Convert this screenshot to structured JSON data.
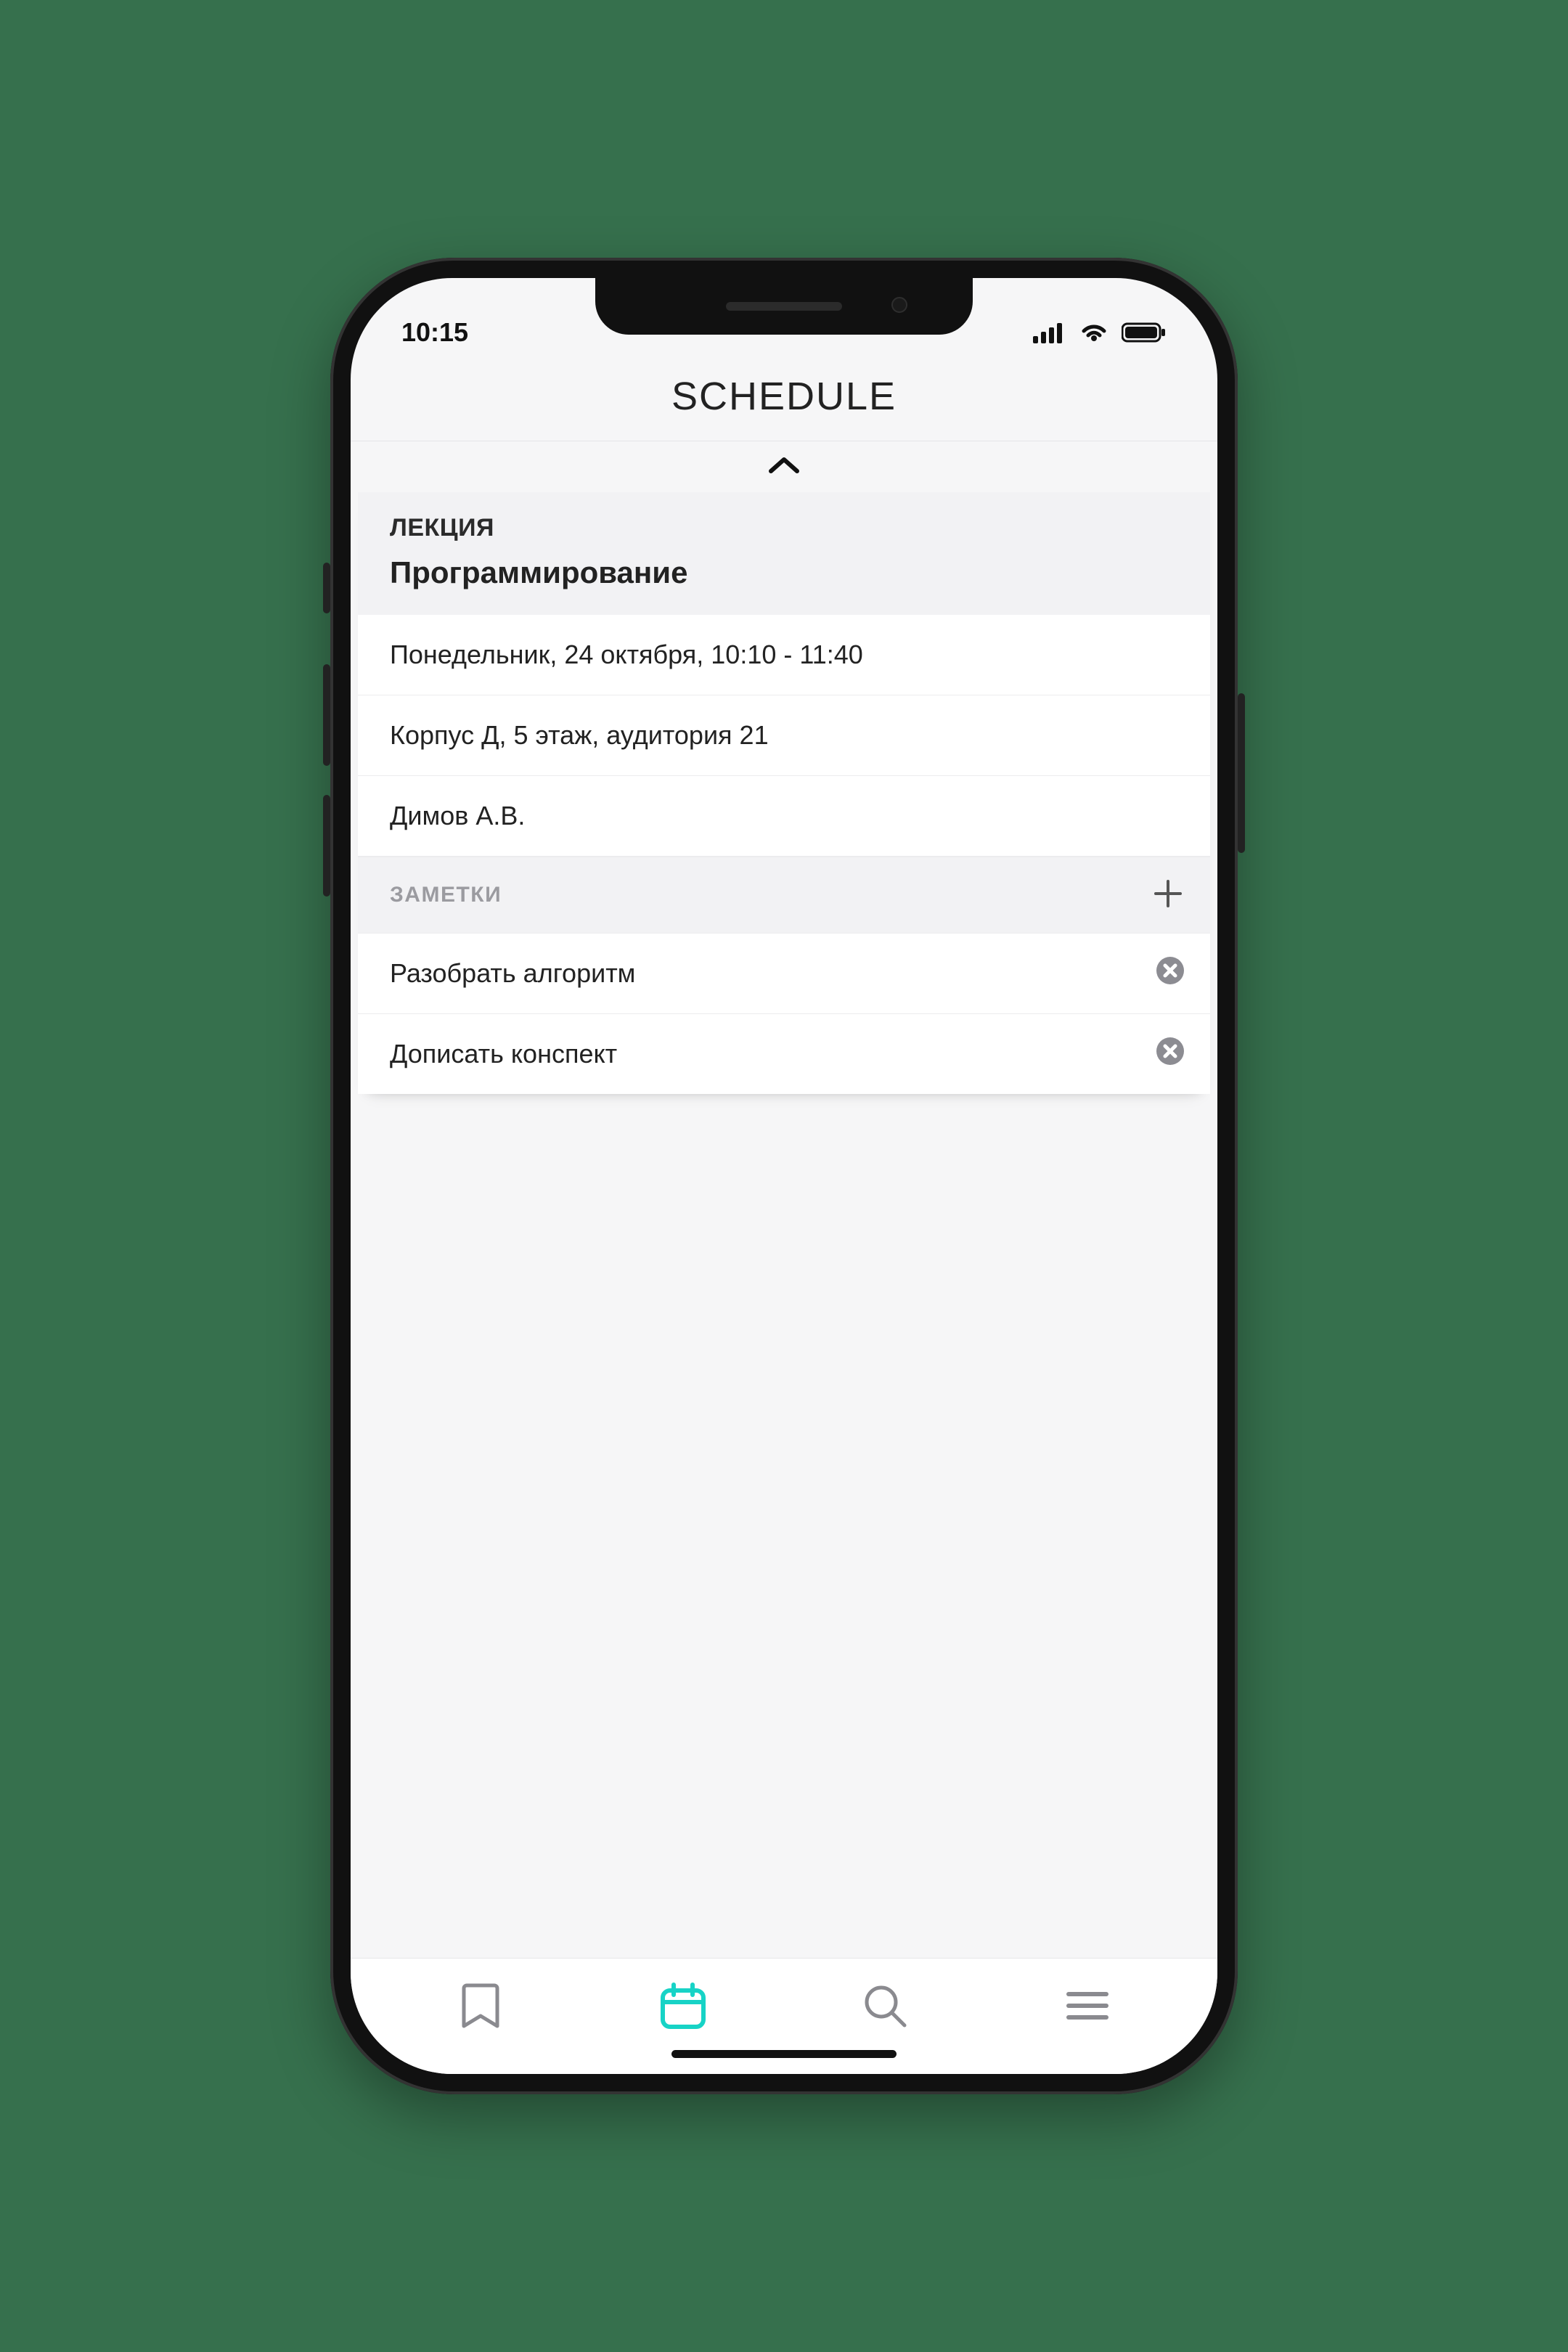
{
  "status": {
    "time": "10:15"
  },
  "header": {
    "title": "SCHEDULE"
  },
  "lecture": {
    "kind": "ЛЕКЦИЯ",
    "subject": "Программирование",
    "datetime": "Понедельник, 24 октября, 10:10 - 11:40",
    "location": "Корпус Д, 5 этаж, аудитория 21",
    "teacher": "Димов А.В."
  },
  "notes": {
    "label": "ЗАМЕТКИ",
    "items": [
      {
        "text": "Разобрать алгоритм"
      },
      {
        "text": "Дописать конспект"
      }
    ]
  },
  "tabs": {
    "active_index": 1,
    "icons": [
      "bookmark-icon",
      "calendar-icon",
      "search-icon",
      "menu-icon"
    ]
  },
  "colors": {
    "accent": "#17d3c6",
    "bg_page": "#36704d",
    "grey_text": "#9b9ba0",
    "delete_btn": "#8c8c92"
  }
}
